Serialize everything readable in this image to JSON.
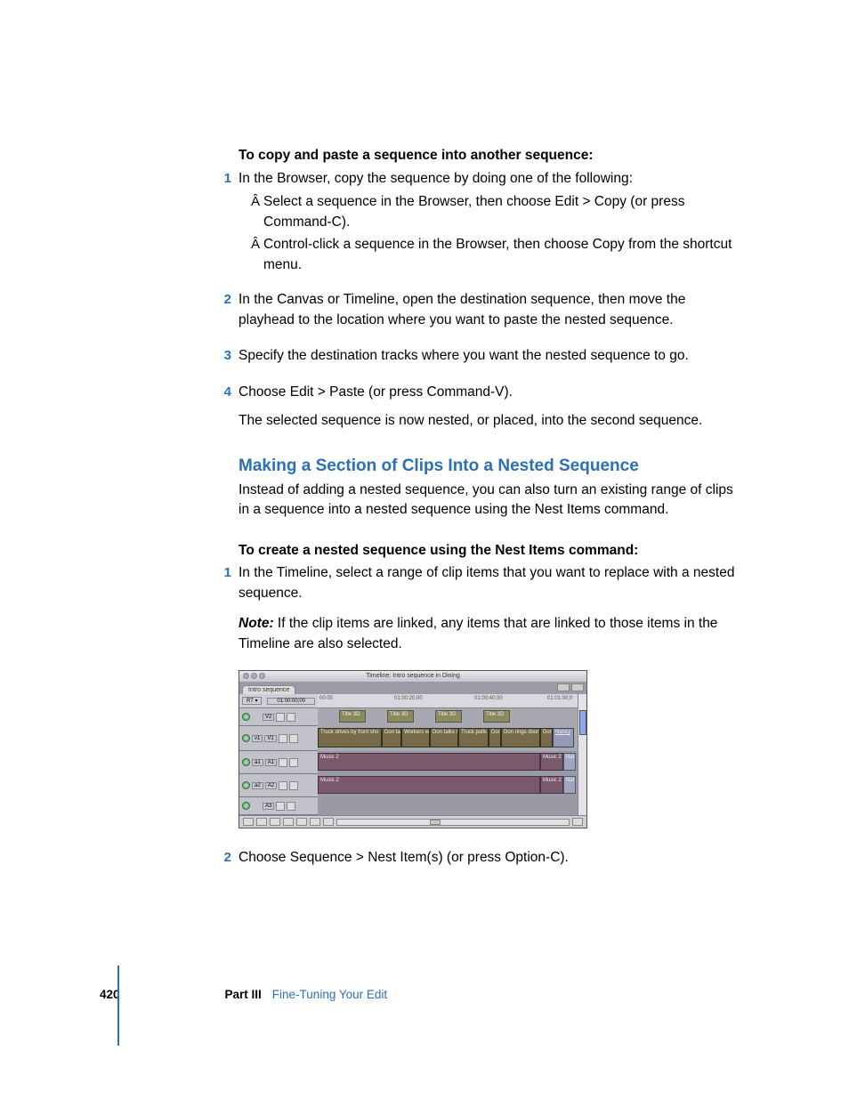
{
  "section1": {
    "heading": "To copy and paste a sequence into another sequence:",
    "step1": "In the Browser, copy the sequence by doing one of the following:",
    "bullet1": "Select a sequence in the Browser, then choose Edit > Copy (or press Command-C).",
    "bullet2": "Control-click a sequence in the Browser, then choose Copy from the shortcut menu.",
    "step2": "In the Canvas or Timeline, open the destination sequence, then move the playhead to the location where you want to paste the nested sequence.",
    "step3": "Specify the destination tracks where you want the nested sequence to go.",
    "step4": "Choose Edit > Paste (or press Command-V).",
    "result": "The selected sequence is now nested, or placed, into the second sequence."
  },
  "section2": {
    "title": "Making a Section of Clips Into a Nested Sequence",
    "intro": "Instead of adding a nested sequence, you can also turn an existing range of clips in a sequence into a nested sequence using the Nest Items command.",
    "heading": "To create a nested sequence using the Nest Items command:",
    "step1": "In the Timeline, select a range of clip items that you want to replace with a nested sequence.",
    "note_label": "Note:",
    "note_body": "  If the clip items are linked, any items that are linked to those items in the Timeline are also selected.",
    "step2": "Choose Sequence > Nest Item(s) (or press Option-C)."
  },
  "nums": {
    "n1": "1",
    "n2": "2",
    "n3": "3",
    "n4": "4"
  },
  "timeline": {
    "title": "Timeline: Intro sequence in Dining",
    "tab": "Intro sequence",
    "rt": "RT ▾",
    "timecode": "01:00:00;00",
    "ruler": {
      "t0": "00:00",
      "t1": "01:00:20;00",
      "t2": "01:00:40;00",
      "t3": "01:01:00;0"
    },
    "tracks": {
      "v2": "V2",
      "v1l": "v1",
      "v1": "V1",
      "a1l": "a1",
      "a1": "A1",
      "a2l": "a2",
      "a2": "A2",
      "a3": "A3"
    },
    "clips": {
      "title3d": "Title 3D",
      "c1": "Truck drives by front sho",
      "c2": "Don tal",
      "c3": "Workers w",
      "c4": "Don talks t",
      "c5": "Truck pulls",
      "c6": "Don",
      "c7": "Don rings door",
      "c8": "Don",
      "c9": "Nancy",
      "music": "Music 2",
      "nan": "Nan"
    }
  },
  "footer": {
    "page": "420",
    "part": "Part III",
    "title": "Fine-Tuning Your Edit"
  }
}
